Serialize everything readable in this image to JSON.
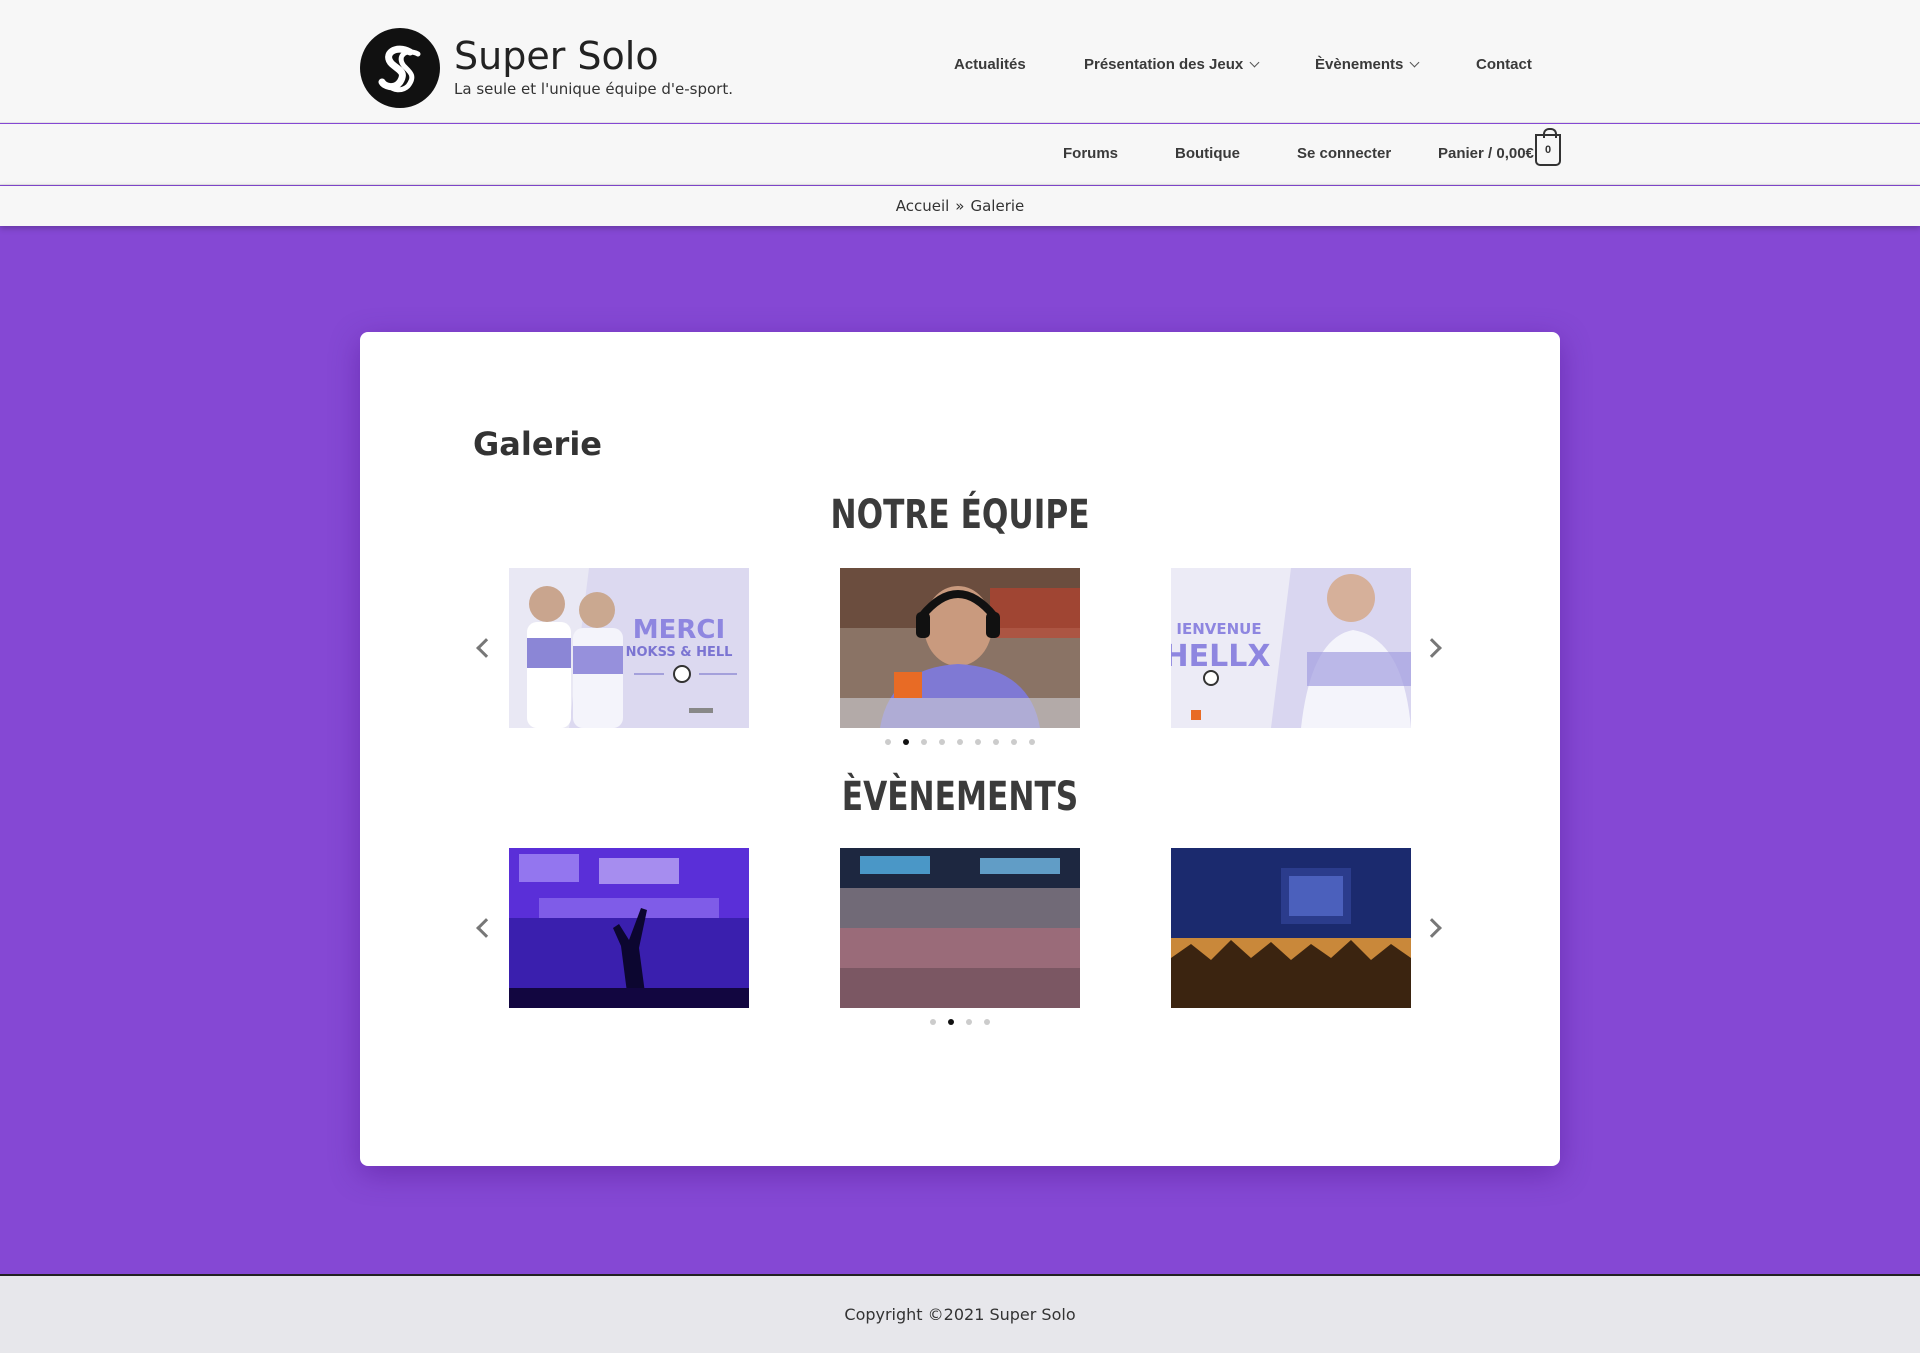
{
  "header": {
    "site_title": "Super Solo",
    "tagline": "La seule et l'unique équipe d'e-sport.",
    "nav": [
      {
        "label": "Actualités"
      },
      {
        "label": "Présentation des Jeux"
      },
      {
        "label": "Èvènements"
      },
      {
        "label": "Contact"
      }
    ],
    "secondary_nav": [
      {
        "label": "Forums"
      },
      {
        "label": "Boutique"
      },
      {
        "label": "Se connecter"
      },
      {
        "label": "Panier / 0,00€"
      }
    ],
    "cart_count": "0"
  },
  "breadcrumb": {
    "home": "Accueil",
    "sep": "»",
    "current": "Galerie"
  },
  "page": {
    "title": "Galerie",
    "sections": [
      {
        "title": "NOTRE ÉQUIPE",
        "slides": [
          {
            "text_line1": "MERCI",
            "text_line2": "NOKSS & HELL"
          },
          {
            "text_line1": "",
            "text_line2": ""
          },
          {
            "text_line1": "IENVENUE",
            "text_line2": "HELLX"
          }
        ],
        "dot_count": 9,
        "active_dot": 1
      },
      {
        "title": "ÈVÈNEMENTS",
        "slides": [
          {},
          {},
          {}
        ],
        "dot_count": 4,
        "active_dot": 1
      }
    ]
  },
  "footer": {
    "copyright": "Copyright ©2021 Super Solo"
  },
  "colors": {
    "background_purple": "#8548d4",
    "header_bg": "#f7f7f7",
    "card_bg": "#ffffff"
  }
}
